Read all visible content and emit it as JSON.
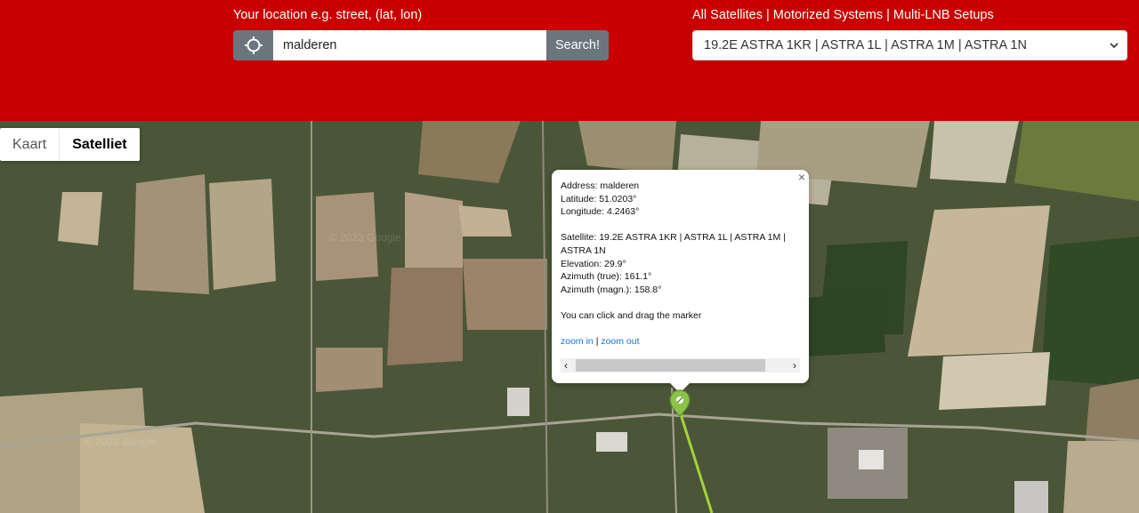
{
  "header": {
    "location_label": "Your location e.g. street, (lat, lon)",
    "satellite_links": "All Satellites | Motorized Systems | Multi-LNB Setups",
    "search_value": "malderen",
    "search_button": "Search!",
    "satellite_selected": "19.2E ASTRA 1KR | ASTRA 1L | ASTRA 1M | ASTRA 1N"
  },
  "map": {
    "type_options": [
      "Kaart",
      "Satelliet"
    ],
    "active_type": "Satelliet",
    "watermark": "© 2023 Google"
  },
  "infowindow": {
    "address": "Address: malderen",
    "latitude": "Latitude: 51.0203°",
    "longitude": "Longitude: 4.2463°",
    "satellite_line1": "Satellite: 19.2E ASTRA 1KR | ASTRA 1L | ASTRA 1M |",
    "satellite_line2": "ASTRA 1N",
    "elevation": "Elevation: 29.9°",
    "azimuth_true": "Azimuth (true): 161.1°",
    "azimuth_magn": "Azimuth (magn.): 158.8°",
    "drag_hint": "You can click and drag the marker",
    "zoom_in": "zoom in",
    "separator": "|",
    "zoom_out": "zoom out",
    "close_glyph": "×"
  },
  "colors": {
    "header_bg": "#c80000",
    "button_gray": "#6c757d",
    "link_blue": "#1a73e8",
    "marker_green": "#8bc34a"
  }
}
